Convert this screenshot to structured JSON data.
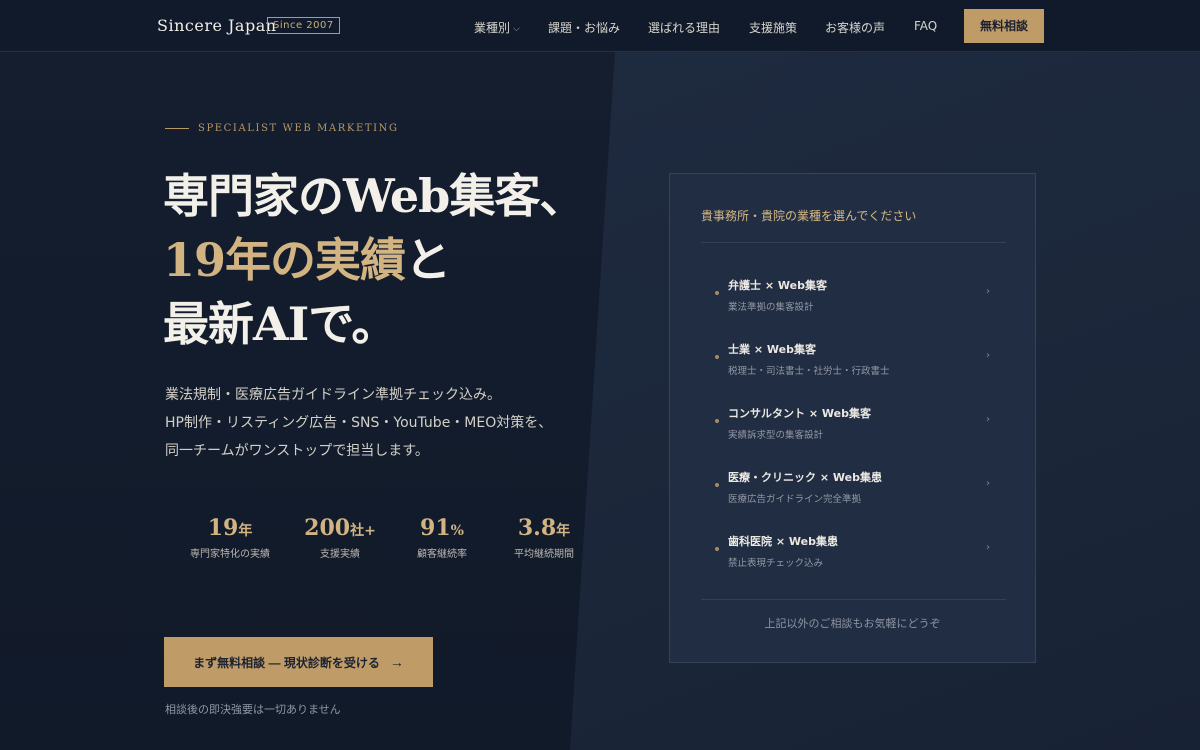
{
  "header": {
    "logo": "Sincere Japan",
    "since": "Since 2007",
    "nav": [
      {
        "label": "業種別",
        "dropdown": true
      },
      {
        "label": "課題・お悩み"
      },
      {
        "label": "選ばれる理由"
      },
      {
        "label": "支援施策"
      },
      {
        "label": "お客様の声"
      },
      {
        "label": "FAQ"
      }
    ],
    "cta": "無料相談"
  },
  "hero": {
    "eyebrow": "SPECIALIST WEB MARKETING",
    "headline": {
      "line1": "専門家のWeb集客、",
      "line2_accent": "19年の実績",
      "line2_rest": "と",
      "line3": "最新AIで。"
    },
    "lede": [
      "業法規制・医療広告ガイドライン準拠チェック込み。",
      "HP制作・リスティング広告・SNS・YouTube・MEO対策を、",
      "同一チームがワンストップで担当します。"
    ],
    "stats": [
      {
        "value": "19",
        "unit": "年",
        "label": "専門家特化の実績"
      },
      {
        "value": "200",
        "unit": "社+",
        "label": "支援実績"
      },
      {
        "value": "91",
        "unit": "%",
        "label": "顧客継続率"
      },
      {
        "value": "3.8",
        "unit": "年",
        "label": "平均継続期間"
      }
    ],
    "cta": "まず無料相談 — 現状診断を受ける",
    "cta_arrow": "→",
    "note": "相談後の即決強要は一切ありません"
  },
  "selector": {
    "title": "貴事務所・貴院の業種を選んでください",
    "options": [
      {
        "title": "弁護士 × Web集客",
        "sub": "業法準拠の集客設計"
      },
      {
        "title": "士業 × Web集客",
        "sub": "税理士・司法書士・社労士・行政書士"
      },
      {
        "title": "コンサルタント × Web集客",
        "sub": "実績訴求型の集客設計"
      },
      {
        "title": "医療・クリニック × Web集患",
        "sub": "医療広告ガイドライン完全準拠"
      },
      {
        "title": "歯科医院 × Web集患",
        "sub": "禁止表現チェック込み"
      }
    ],
    "chevron": "›",
    "footer": "上記以外のご相談もお気軽にどうぞ"
  },
  "colors": {
    "accent": "#bf9b68",
    "background": "#121b2b",
    "panel": "#212d42"
  }
}
